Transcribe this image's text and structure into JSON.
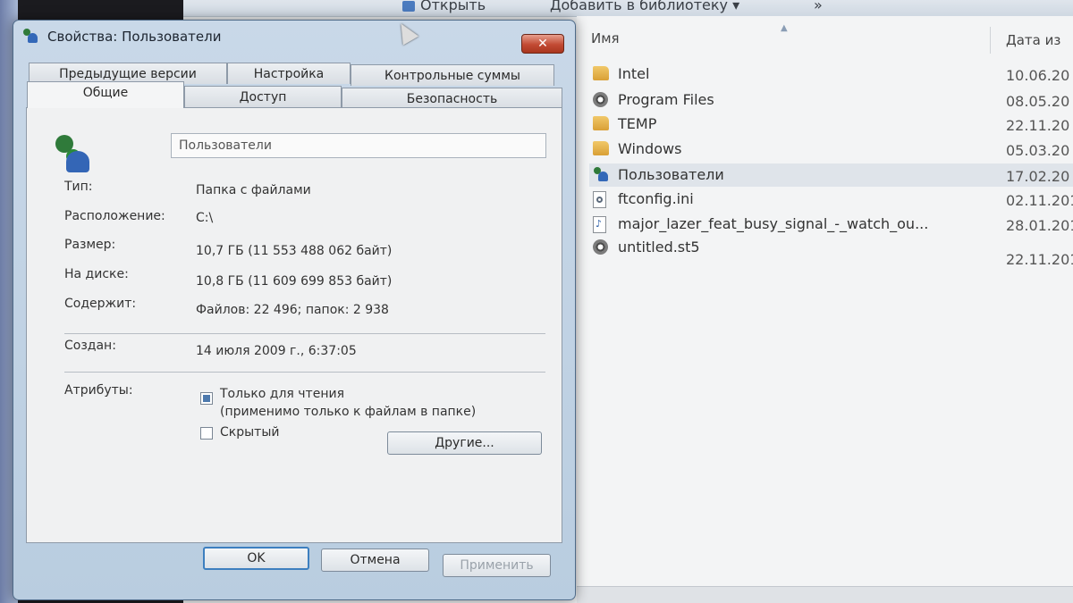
{
  "explorer": {
    "toolbar": {
      "open": "Открыть",
      "add_to_library": "Добавить в библиотеку",
      "more": "»"
    },
    "columns": {
      "name": "Имя",
      "date": "Дата из"
    },
    "files": [
      {
        "name": "Intel",
        "date": "10.06.20",
        "icon": "folder-icon"
      },
      {
        "name": "Program Files",
        "date": "08.05.20",
        "icon": "disc-icon"
      },
      {
        "name": "TEMP",
        "date": "22.11.20",
        "icon": "folder-icon"
      },
      {
        "name": "Windows",
        "date": "05.03.20",
        "icon": "folder-icon"
      },
      {
        "name": "Пользователи",
        "date": "17.02.20",
        "icon": "users-icon"
      },
      {
        "name": "ftconfig.ini",
        "date": "02.11.201",
        "icon": "config-file-icon"
      },
      {
        "name": "major_lazer_feat_busy_signal_-_watch_ou...",
        "date": "28.01.201",
        "icon": "audio-file-icon"
      },
      {
        "name": "untitled.st5",
        "date": "22.11.201",
        "icon": "disc-icon"
      }
    ]
  },
  "dialog": {
    "title": "Свойства: Пользователи",
    "close": "✕",
    "tabs": {
      "previous_versions": "Предыдущие версии",
      "customize": "Настройка",
      "checksums": "Контрольные суммы",
      "general": "Общие",
      "sharing": "Доступ",
      "security": "Безопасность"
    },
    "name_value": "Пользователи",
    "fields": {
      "type_label": "Тип:",
      "type_value": "Папка с файлами",
      "location_label": "Расположение:",
      "location_value": "C:\\",
      "size_label": "Размер:",
      "size_value": "10,7 ГБ (11 553 488 062 байт)",
      "disk_label": "На диске:",
      "disk_value": "10,8 ГБ (11 609 699 853 байт)",
      "contains_label": "Содержит:",
      "contains_value": "Файлов: 22 496; папок: 2 938",
      "created_label": "Создан:",
      "created_value": "14 июля 2009 г., 6:37:05"
    },
    "attributes": {
      "label": "Атрибуты:",
      "readonly": "Только для чтения",
      "readonly_note": "(применимо только к файлам в папке)",
      "hidden": "Скрытый",
      "other_button": "Другие..."
    },
    "buttons": {
      "ok": "OK",
      "cancel": "Отмена",
      "apply": "Применить"
    }
  }
}
